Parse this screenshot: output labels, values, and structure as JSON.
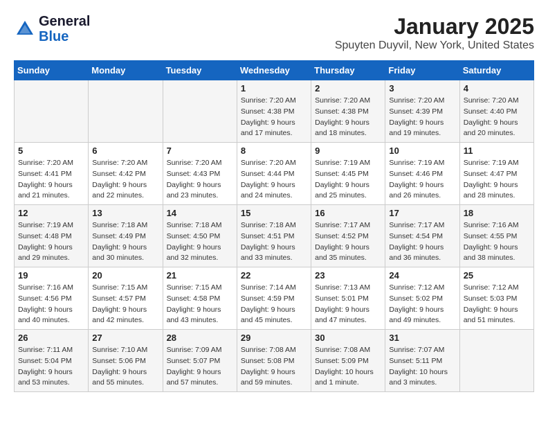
{
  "logo": {
    "line1": "General",
    "line2": "Blue"
  },
  "title": "January 2025",
  "subtitle": "Spuyten Duyvil, New York, United States",
  "weekdays": [
    "Sunday",
    "Monday",
    "Tuesday",
    "Wednesday",
    "Thursday",
    "Friday",
    "Saturday"
  ],
  "weeks": [
    [
      {
        "day": "",
        "info": ""
      },
      {
        "day": "",
        "info": ""
      },
      {
        "day": "",
        "info": ""
      },
      {
        "day": "1",
        "info": "Sunrise: 7:20 AM\nSunset: 4:38 PM\nDaylight: 9 hours\nand 17 minutes."
      },
      {
        "day": "2",
        "info": "Sunrise: 7:20 AM\nSunset: 4:38 PM\nDaylight: 9 hours\nand 18 minutes."
      },
      {
        "day": "3",
        "info": "Sunrise: 7:20 AM\nSunset: 4:39 PM\nDaylight: 9 hours\nand 19 minutes."
      },
      {
        "day": "4",
        "info": "Sunrise: 7:20 AM\nSunset: 4:40 PM\nDaylight: 9 hours\nand 20 minutes."
      }
    ],
    [
      {
        "day": "5",
        "info": "Sunrise: 7:20 AM\nSunset: 4:41 PM\nDaylight: 9 hours\nand 21 minutes."
      },
      {
        "day": "6",
        "info": "Sunrise: 7:20 AM\nSunset: 4:42 PM\nDaylight: 9 hours\nand 22 minutes."
      },
      {
        "day": "7",
        "info": "Sunrise: 7:20 AM\nSunset: 4:43 PM\nDaylight: 9 hours\nand 23 minutes."
      },
      {
        "day": "8",
        "info": "Sunrise: 7:20 AM\nSunset: 4:44 PM\nDaylight: 9 hours\nand 24 minutes."
      },
      {
        "day": "9",
        "info": "Sunrise: 7:19 AM\nSunset: 4:45 PM\nDaylight: 9 hours\nand 25 minutes."
      },
      {
        "day": "10",
        "info": "Sunrise: 7:19 AM\nSunset: 4:46 PM\nDaylight: 9 hours\nand 26 minutes."
      },
      {
        "day": "11",
        "info": "Sunrise: 7:19 AM\nSunset: 4:47 PM\nDaylight: 9 hours\nand 28 minutes."
      }
    ],
    [
      {
        "day": "12",
        "info": "Sunrise: 7:19 AM\nSunset: 4:48 PM\nDaylight: 9 hours\nand 29 minutes."
      },
      {
        "day": "13",
        "info": "Sunrise: 7:18 AM\nSunset: 4:49 PM\nDaylight: 9 hours\nand 30 minutes."
      },
      {
        "day": "14",
        "info": "Sunrise: 7:18 AM\nSunset: 4:50 PM\nDaylight: 9 hours\nand 32 minutes."
      },
      {
        "day": "15",
        "info": "Sunrise: 7:18 AM\nSunset: 4:51 PM\nDaylight: 9 hours\nand 33 minutes."
      },
      {
        "day": "16",
        "info": "Sunrise: 7:17 AM\nSunset: 4:52 PM\nDaylight: 9 hours\nand 35 minutes."
      },
      {
        "day": "17",
        "info": "Sunrise: 7:17 AM\nSunset: 4:54 PM\nDaylight: 9 hours\nand 36 minutes."
      },
      {
        "day": "18",
        "info": "Sunrise: 7:16 AM\nSunset: 4:55 PM\nDaylight: 9 hours\nand 38 minutes."
      }
    ],
    [
      {
        "day": "19",
        "info": "Sunrise: 7:16 AM\nSunset: 4:56 PM\nDaylight: 9 hours\nand 40 minutes."
      },
      {
        "day": "20",
        "info": "Sunrise: 7:15 AM\nSunset: 4:57 PM\nDaylight: 9 hours\nand 42 minutes."
      },
      {
        "day": "21",
        "info": "Sunrise: 7:15 AM\nSunset: 4:58 PM\nDaylight: 9 hours\nand 43 minutes."
      },
      {
        "day": "22",
        "info": "Sunrise: 7:14 AM\nSunset: 4:59 PM\nDaylight: 9 hours\nand 45 minutes."
      },
      {
        "day": "23",
        "info": "Sunrise: 7:13 AM\nSunset: 5:01 PM\nDaylight: 9 hours\nand 47 minutes."
      },
      {
        "day": "24",
        "info": "Sunrise: 7:12 AM\nSunset: 5:02 PM\nDaylight: 9 hours\nand 49 minutes."
      },
      {
        "day": "25",
        "info": "Sunrise: 7:12 AM\nSunset: 5:03 PM\nDaylight: 9 hours\nand 51 minutes."
      }
    ],
    [
      {
        "day": "26",
        "info": "Sunrise: 7:11 AM\nSunset: 5:04 PM\nDaylight: 9 hours\nand 53 minutes."
      },
      {
        "day": "27",
        "info": "Sunrise: 7:10 AM\nSunset: 5:06 PM\nDaylight: 9 hours\nand 55 minutes."
      },
      {
        "day": "28",
        "info": "Sunrise: 7:09 AM\nSunset: 5:07 PM\nDaylight: 9 hours\nand 57 minutes."
      },
      {
        "day": "29",
        "info": "Sunrise: 7:08 AM\nSunset: 5:08 PM\nDaylight: 9 hours\nand 59 minutes."
      },
      {
        "day": "30",
        "info": "Sunrise: 7:08 AM\nSunset: 5:09 PM\nDaylight: 10 hours\nand 1 minute."
      },
      {
        "day": "31",
        "info": "Sunrise: 7:07 AM\nSunset: 5:11 PM\nDaylight: 10 hours\nand 3 minutes."
      },
      {
        "day": "",
        "info": ""
      }
    ]
  ]
}
